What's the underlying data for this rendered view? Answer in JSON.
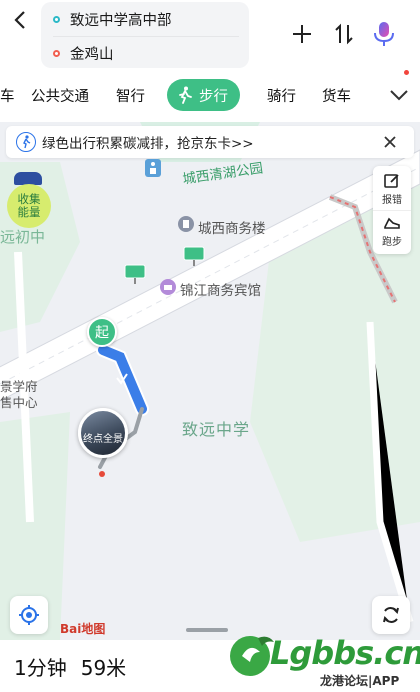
{
  "route": {
    "start": "致远中学高中部",
    "end": "金鸡山"
  },
  "tabs": [
    {
      "label": "车"
    },
    {
      "label": "公共交通"
    },
    {
      "label": "智行"
    },
    {
      "label": "步行",
      "active": true
    },
    {
      "label": "骑行"
    },
    {
      "label": "货车"
    }
  ],
  "banner": {
    "text": "绿色出行积累碳减排，抢京东卡>>"
  },
  "side_tools": {
    "report": "报错",
    "run": "跑步"
  },
  "map": {
    "labels": {
      "lake": "城西清湖公园",
      "building": "城西商务楼",
      "hotel": "锦江商务宾馆",
      "school_left": "远初中",
      "school_main": "致远中学",
      "left1": "景学府",
      "left2": "售中心"
    },
    "start_marker": "起",
    "panorama": "终点全景",
    "carbon": {
      "line1": "收集",
      "line2": "能量"
    },
    "logo": "Bai地图"
  },
  "summary": {
    "time": "1分钟",
    "distance": "59米"
  },
  "watermark": {
    "text": "Lgbbs.cn",
    "sub": "龙港论坛|APP"
  },
  "colors": {
    "accent": "#3ebf86",
    "route": "#3b7ee8",
    "brand_blue": "#2b73e8"
  }
}
